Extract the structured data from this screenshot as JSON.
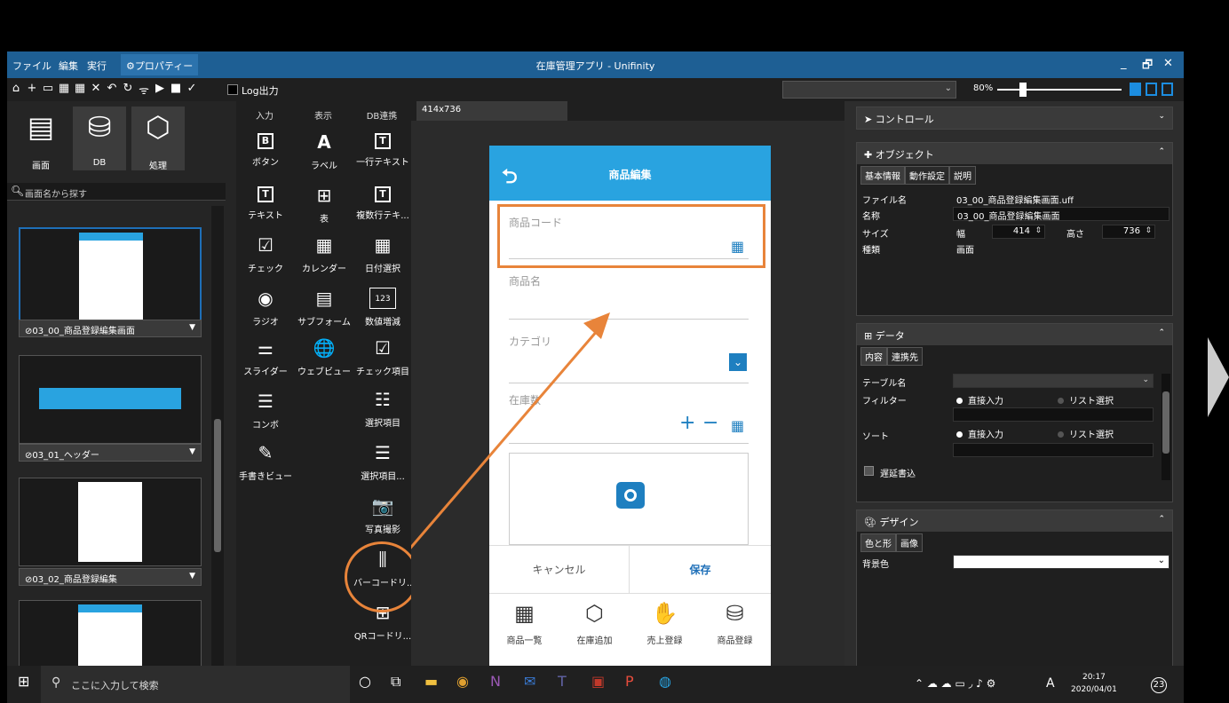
{
  "window": {
    "title": "在庫管理アプリ - Unifinity",
    "menu": [
      "ファイル",
      "編集",
      "実行",
      "⚙プロパティー"
    ],
    "controls": [
      "_",
      "🗗",
      "✕"
    ]
  },
  "toolbar": {
    "icons": [
      "⌂",
      "+",
      "▭",
      "▦",
      "▦",
      "✕",
      "↶",
      "↻",
      "ᯤ",
      "▶",
      "■",
      "✓"
    ],
    "log_label": "Log出力",
    "zoom": "80%"
  },
  "left": {
    "categories": [
      "画面",
      "DB",
      "処理"
    ],
    "search_placeholder": "画面名から探す",
    "screens": [
      "⊘03_00_商品登録編集画面",
      "⊘03_01_ヘッダー",
      "⊘03_02_商品登録編集"
    ]
  },
  "palette": {
    "headers": [
      "入力",
      "表示",
      "DB連携"
    ],
    "col1": [
      {
        "icon": "B",
        "label": "ボタン"
      },
      {
        "icon": "T",
        "label": "テキスト"
      },
      {
        "icon": "☑",
        "label": "チェック"
      },
      {
        "icon": "◉",
        "label": "ラジオ"
      },
      {
        "icon": "⚌",
        "label": "スライダー"
      },
      {
        "icon": "☰",
        "label": "コンボ"
      },
      {
        "icon": "✎",
        "label": "手書きビュー"
      }
    ],
    "col2": [
      {
        "icon": "A",
        "label": "ラベル"
      },
      {
        "icon": "⊞",
        "label": "表"
      },
      {
        "icon": "▦",
        "label": "カレンダー"
      },
      {
        "icon": "▤",
        "label": "サブフォーム"
      },
      {
        "icon": "🌐",
        "label": "ウェブビュー"
      }
    ],
    "col3": [
      {
        "icon": "T",
        "label": "一行テキスト"
      },
      {
        "icon": "T",
        "label": "複数行テキ..."
      },
      {
        "icon": "▦",
        "label": "日付選択"
      },
      {
        "icon": "123",
        "label": "数値増減"
      },
      {
        "icon": "☑",
        "label": "チェック項目"
      },
      {
        "icon": "☷",
        "label": "選択項目"
      },
      {
        "icon": "☰",
        "label": "選択項目..."
      },
      {
        "icon": "📷",
        "label": "写真撮影"
      },
      {
        "icon": "⫼",
        "label": "バーコードリ..."
      },
      {
        "icon": "⊞",
        "label": "QRコードリ..."
      }
    ]
  },
  "canvas": {
    "tab": "414x736",
    "header_title": "商品編集",
    "fields": [
      "商品コード",
      "商品名",
      "カテゴリ",
      "在庫数"
    ],
    "cancel": "キャンセル",
    "save": "保存",
    "tabbar": [
      {
        "icon": "▦",
        "label": "商品一覧"
      },
      {
        "icon": "⬡",
        "label": "在庫追加"
      },
      {
        "icon": "✋",
        "label": "売上登録"
      },
      {
        "icon": "⛁",
        "label": "商品登録"
      }
    ]
  },
  "right": {
    "control_label": "コントロール",
    "object": {
      "title": "オブジェクト",
      "tabs": [
        "基本情報",
        "動作設定",
        "説明"
      ],
      "rows": [
        {
          "k": "ファイル名",
          "v": "03_00_商品登録編集画面.uff"
        },
        {
          "k": "名称",
          "v": "03_00_商品登録編集画面"
        },
        {
          "k": "サイズ",
          "v": "幅"
        },
        {
          "k": "種類",
          "v": "画面"
        }
      ],
      "width": "414",
      "height_label": "高さ",
      "height": "736"
    },
    "data": {
      "title": "データ",
      "tabs": [
        "内容",
        "連携先"
      ],
      "table_label": "テーブル名",
      "filter_label": "フィルター",
      "sort_label": "ソート",
      "direct": "直接入力",
      "list": "リスト選択",
      "delay": "遅延書込"
    },
    "design": {
      "title": "デザイン",
      "tabs": [
        "色と形",
        "画像"
      ],
      "bg_label": "背景色"
    }
  },
  "taskbar": {
    "search": "ここに入力して検索",
    "time": "20:17",
    "date": "2020/04/01",
    "ime": "A",
    "notif": "23"
  }
}
